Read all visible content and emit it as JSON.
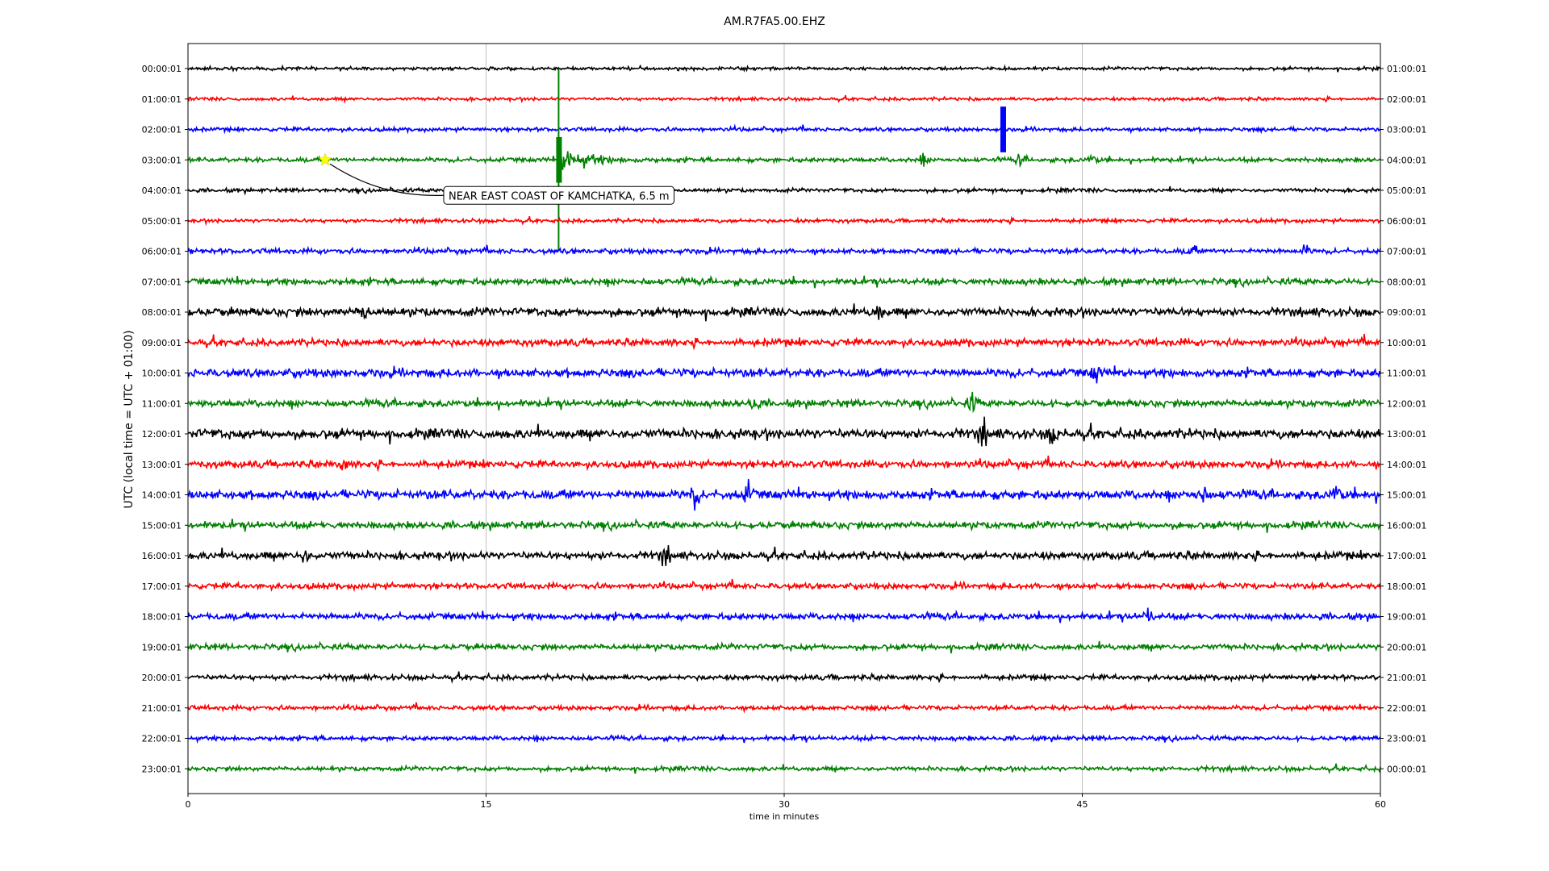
{
  "chart_data": {
    "type": "line",
    "title": "AM.R7FA5.00.EHZ",
    "xlabel": "time in minutes",
    "ylabel": "UTC (local time = UTC + 01:00)",
    "xlim": [
      0,
      60
    ],
    "x_ticks": [
      "0",
      "15",
      "30",
      "45",
      "60"
    ],
    "x_tick_values": [
      0,
      15,
      30,
      45,
      60
    ],
    "grid": "vertical",
    "left_labels": [
      "00:00:01",
      "01:00:01",
      "02:00:01",
      "03:00:01",
      "04:00:01",
      "05:00:01",
      "06:00:01",
      "07:00:01",
      "08:00:01",
      "09:00:01",
      "10:00:01",
      "11:00:01",
      "12:00:01",
      "13:00:01",
      "14:00:01",
      "15:00:01",
      "16:00:01",
      "17:00:01",
      "18:00:01",
      "19:00:01",
      "20:00:01",
      "21:00:01",
      "22:00:01",
      "23:00:01"
    ],
    "right_labels": [
      "01:00:01",
      "02:00:01",
      "03:00:01",
      "04:00:01",
      "05:00:01",
      "06:00:01",
      "07:00:01",
      "08:00:01",
      "09:00:01",
      "10:00:01",
      "11:00:01",
      "12:00:01",
      "13:00:01",
      "14:00:01",
      "15:00:01",
      "16:00:01",
      "17:00:01",
      "18:00:01",
      "19:00:01",
      "20:00:01",
      "21:00:01",
      "22:00:01",
      "23:00:01",
      "00:00:01"
    ],
    "trace_colors": [
      "#000000",
      "#ff0000",
      "#0000ff",
      "#008000"
    ],
    "noise_level": [
      0.05,
      0.05,
      0.06,
      0.07,
      0.06,
      0.06,
      0.08,
      0.1,
      0.13,
      0.11,
      0.13,
      0.11,
      0.15,
      0.11,
      0.14,
      0.11,
      0.12,
      0.09,
      0.1,
      0.09,
      0.08,
      0.07,
      0.07,
      0.07
    ],
    "events": [
      {
        "row": 3,
        "minute": 18.7,
        "label": "NEAR EAST COAST OF KAMCHATKA, 6.5 m",
        "marker_minute": 6.9,
        "marker_color": "#ffff00"
      }
    ],
    "large_signals": [
      {
        "row": 3,
        "start_minute": 18.65,
        "duration_minutes": 5,
        "peak_amplitude_rows": 3.0
      },
      {
        "row": 2,
        "start_minute": 41.0,
        "duration_minutes": 0.15,
        "peak_amplitude_rows": 0.5
      }
    ],
    "minor_bursts": [
      {
        "row": 3,
        "minute": 37.0
      },
      {
        "row": 3,
        "minute": 41.9
      },
      {
        "row": 3,
        "minute": 45.5
      },
      {
        "row": 6,
        "minute": 50.5
      },
      {
        "row": 6,
        "minute": 56.2
      },
      {
        "row": 8,
        "minute": 34.7
      },
      {
        "row": 8,
        "minute": 8.8
      },
      {
        "row": 10,
        "minute": 45.7
      },
      {
        "row": 11,
        "minute": 28.5
      },
      {
        "row": 11,
        "minute": 39.5
      },
      {
        "row": 12,
        "minute": 40.0
      },
      {
        "row": 12,
        "minute": 43.5
      },
      {
        "row": 13,
        "minute": 7.8
      },
      {
        "row": 14,
        "minute": 25.5
      },
      {
        "row": 14,
        "minute": 28.2
      },
      {
        "row": 14,
        "minute": 51.0
      },
      {
        "row": 14,
        "minute": 57.8
      },
      {
        "row": 16,
        "minute": 24.0
      },
      {
        "row": 16,
        "minute": 5.8
      },
      {
        "row": 18,
        "minute": 48.3
      }
    ]
  }
}
